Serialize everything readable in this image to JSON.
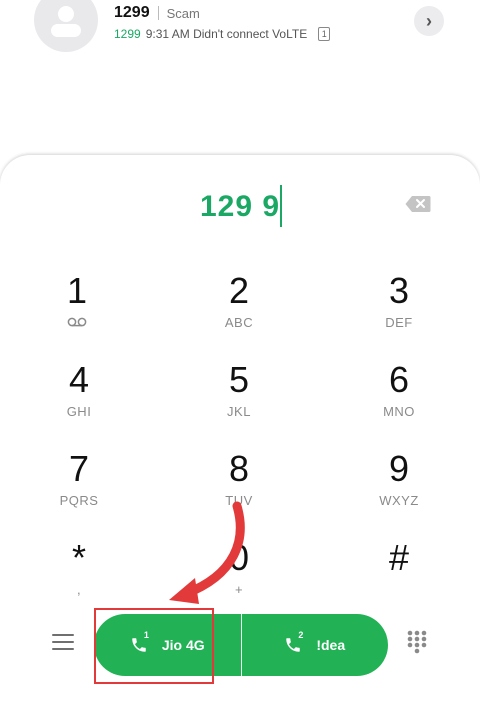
{
  "contact": {
    "number": "1299",
    "tag": "Scam",
    "log_number": "1299",
    "log_detail": "9:31 AM Didn't connect VoLTE",
    "sim_badge": "1"
  },
  "dialer": {
    "entered_number": "129 9",
    "keys": [
      {
        "digit": "1",
        "letters": ""
      },
      {
        "digit": "2",
        "letters": "ABC"
      },
      {
        "digit": "3",
        "letters": "DEF"
      },
      {
        "digit": "4",
        "letters": "GHI"
      },
      {
        "digit": "5",
        "letters": "JKL"
      },
      {
        "digit": "6",
        "letters": "MNO"
      },
      {
        "digit": "7",
        "letters": "PQRS"
      },
      {
        "digit": "8",
        "letters": "TUV"
      },
      {
        "digit": "9",
        "letters": "WXYZ"
      },
      {
        "digit": "*",
        "letters": ","
      },
      {
        "digit": "0",
        "letters": "+"
      },
      {
        "digit": "#",
        "letters": ""
      }
    ]
  },
  "call_bar": {
    "sim1_index": "1",
    "sim1_label": "Jio 4G",
    "sim2_index": "2",
    "sim2_label": "!dea",
    "color": "#22b255"
  },
  "colors": {
    "accent": "#1aa864",
    "annotation": "#e23a3a"
  }
}
